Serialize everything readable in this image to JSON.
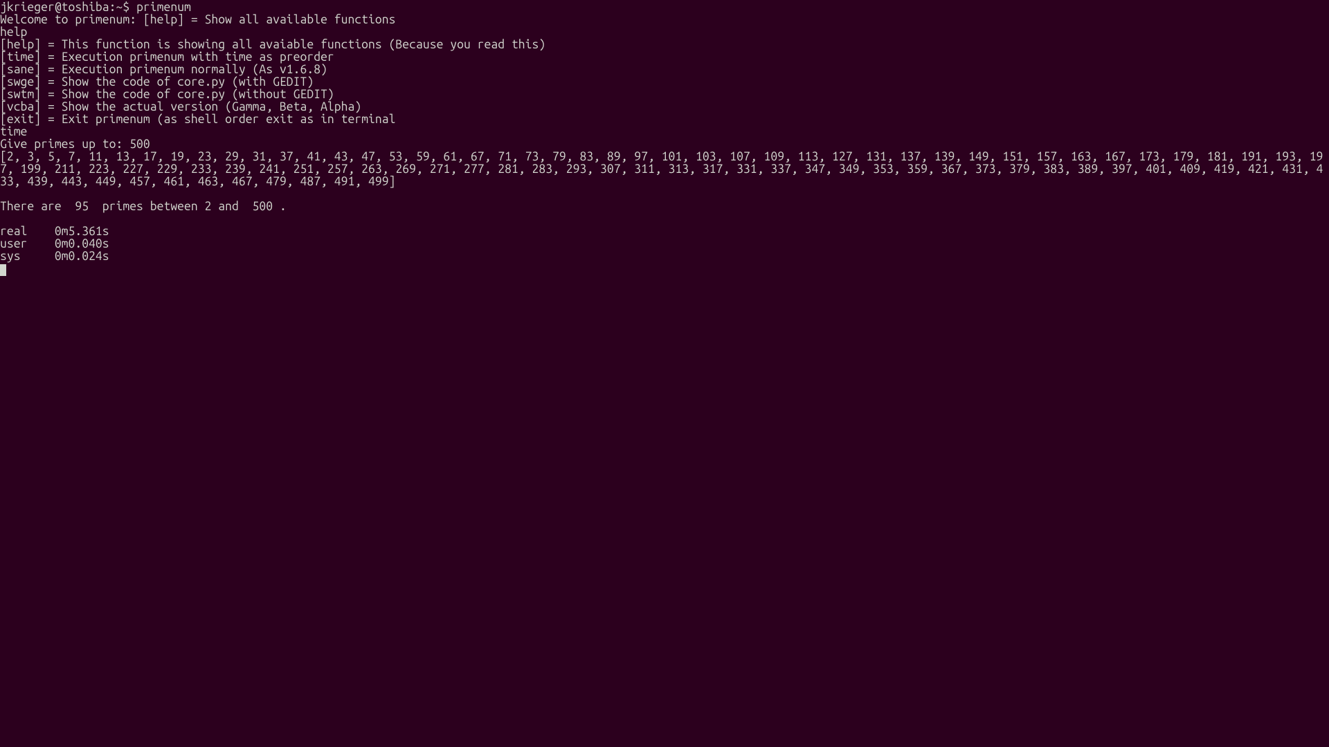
{
  "prompt": {
    "user_host": "jkrieger@toshiba",
    "path": ":~$ ",
    "command": "primenum"
  },
  "welcome": "Welcome to primenum: [help] = Show all available functions",
  "input_help": "help",
  "help_lines": [
    "[help] = This function is showing all avaiable functions (Because you read this)",
    "[time] = Execution primenum with time as preorder",
    "[sane] = Execution primenum normally (As v1.6.8)",
    "[swge] = Show the code of core.py (with GEDIT)",
    "[swtm] = Show the code of core.py (without GEDIT)",
    "[vcba] = Show the actual version (Gamma, Beta, Alpha)",
    "[exit] = Exit primenum (as shell order exit as in terminal"
  ],
  "input_time": "time",
  "give_primes": "Give primes up to: 500",
  "primes_list": "[2, 3, 5, 7, 11, 13, 17, 19, 23, 29, 31, 37, 41, 43, 47, 53, 59, 61, 67, 71, 73, 79, 83, 89, 97, 101, 103, 107, 109, 113, 127, 131, 137, 139, 149, 151, 157, 163, 167, 173, 179, 181, 191, 193, 197, 199, 211, 223, 227, 229, 233, 239, 241, 251, 257, 263, 269, 271, 277, 281, 283, 293, 307, 311, 313, 317, 331, 337, 347, 349, 353, 359, 367, 373, 379, 383, 389, 397, 401, 409, 419, 421, 431, 433, 439, 443, 449, 457, 461, 463, 467, 479, 487, 491, 499]",
  "summary": "There are  95  primes between 2 and  500 .",
  "timing": {
    "real": "real    0m5.361s",
    "user": "user    0m0.040s",
    "sys": "sys     0m0.024s"
  }
}
